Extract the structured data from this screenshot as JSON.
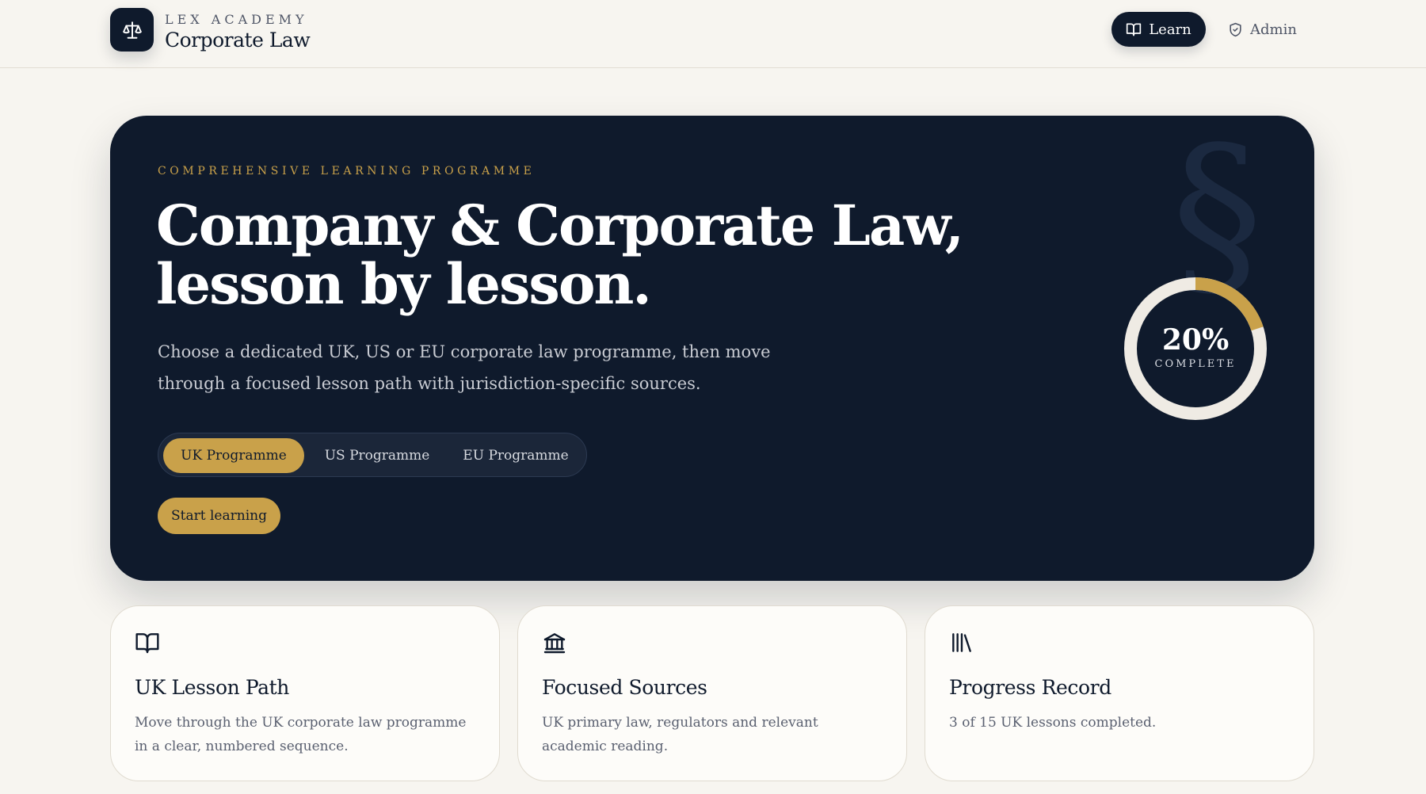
{
  "brand": {
    "kicker": "LEX ACADEMY",
    "title": "Corporate Law",
    "logo_icon": "scales-icon"
  },
  "nav": {
    "learn_label": "Learn",
    "learn_icon": "open-book-icon",
    "admin_label": "Admin",
    "admin_icon": "shield-check-icon"
  },
  "hero": {
    "kicker": "COMPREHENSIVE LEARNING PROGRAMME",
    "headline_line1": "Company & Corporate Law,",
    "headline_line2": "lesson by lesson.",
    "lede": "Choose a dedicated UK, US or EU corporate law programme, then move through a focused lesson path with jurisdiction-specific sources.",
    "decor_glyph": "§",
    "programmes": [
      {
        "label": "UK Programme",
        "active": true
      },
      {
        "label": "US Programme",
        "active": false
      },
      {
        "label": "EU Programme",
        "active": false
      }
    ],
    "start_label": "Start learning",
    "progress": {
      "value": 0.2,
      "percent_text": "20%",
      "label": "COMPLETE"
    }
  },
  "cards": [
    {
      "icon": "open-book-icon",
      "title": "UK Lesson Path",
      "body": "Move through the UK corporate law programme in a clear, numbered sequence."
    },
    {
      "icon": "courthouse-icon",
      "title": "Focused Sources",
      "body": "UK primary law, regulators and relevant academic reading."
    },
    {
      "icon": "library-icon",
      "title": "Progress Record",
      "body": "3 of 15 UK lessons completed."
    }
  ],
  "colors": {
    "navy": "#0f1a2c",
    "gold": "#c9a14a",
    "background": "#f7f5f0",
    "ring_track": "#efebe4"
  }
}
